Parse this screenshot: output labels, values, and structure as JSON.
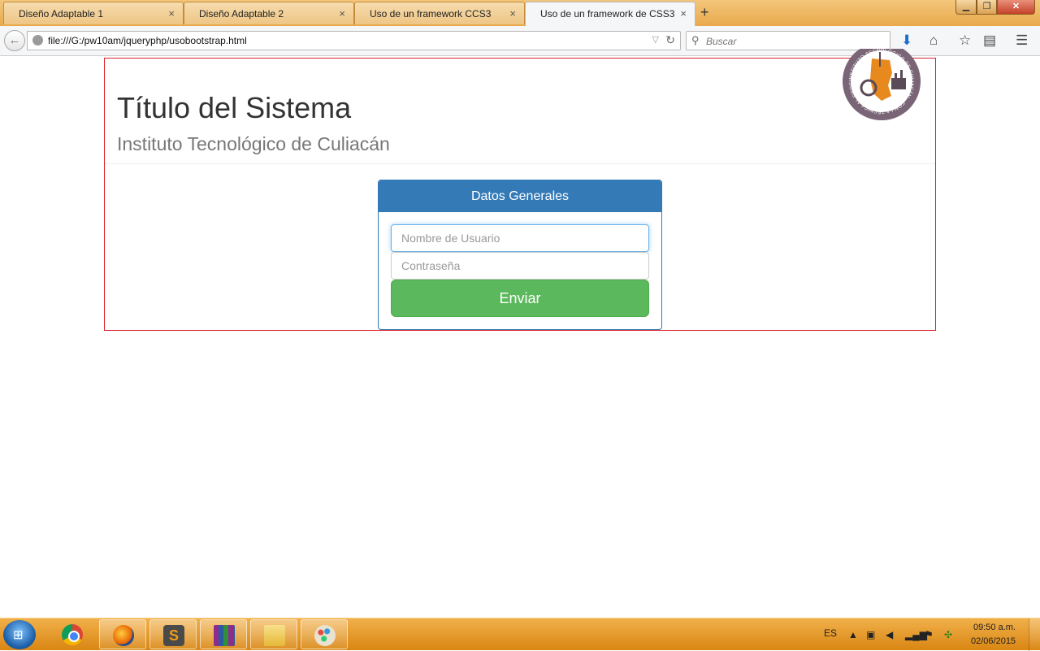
{
  "browser": {
    "tabs": [
      {
        "label": "Diseño Adaptable 1",
        "close": "×"
      },
      {
        "label": "Diseño Adaptable 2",
        "close": "×"
      },
      {
        "label": "Uso de un framework CCS3",
        "close": "×"
      },
      {
        "label": "Uso de un framework de CSS3",
        "close": "×"
      }
    ],
    "new_tab": "+",
    "url": "file:///G:/pw10am/jqueryphp/usobootstrap.html",
    "search_placeholder": "Buscar"
  },
  "page": {
    "title": "Título del Sistema",
    "subtitle": "Instituto Tecnológico de Culiacán",
    "logo_text": "INSTITUTO TECNOLÓGICO DE CULIACÁN · CON LA TÉCNICA AL PROGRESO"
  },
  "form": {
    "heading": "Datos Generales",
    "username_placeholder": "Nombre de Usuario",
    "password_placeholder": "Contraseña",
    "submit_label": "Enviar"
  },
  "taskbar": {
    "language": "ES",
    "time": "09:50 a.m.",
    "date": "02/06/2015"
  },
  "colors": {
    "primary": "#337ab7",
    "success": "#5cb85c",
    "page_border": "#d9232d"
  }
}
